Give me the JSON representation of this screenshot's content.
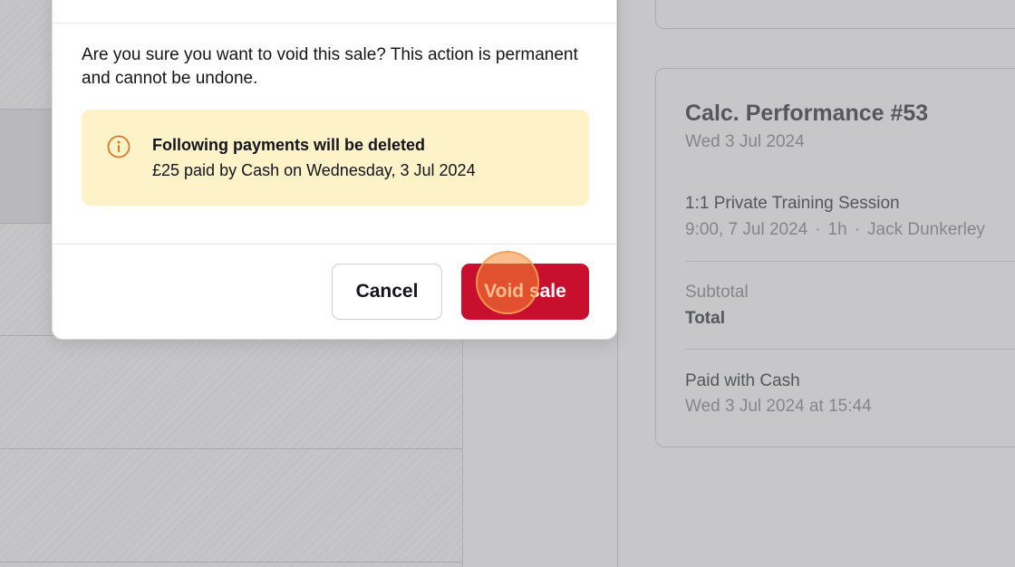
{
  "dialog": {
    "message": "Are you sure you want to void this sale? This action is permanent and cannot be undone.",
    "warning": {
      "icon": "info-icon",
      "title": "Following payments will be deleted",
      "detail": "£25 paid by Cash on Wednesday, 3 Jul 2024",
      "background_color": "#fdf2c8",
      "icon_color": "#d97a2b"
    },
    "cancel_label": "Cancel",
    "void_label": "Void sale",
    "void_color": "#c8102e"
  },
  "sale_summary": {
    "title": "Calc. Performance #53",
    "date": "Wed 3 Jul 2024",
    "item": {
      "name": "1:1 Private Training Session",
      "time": "9:00, 7 Jul 2024",
      "duration": "1h",
      "staff": "Jack Dunkerley"
    },
    "subtotal_label": "Subtotal",
    "total_label": "Total",
    "payment": {
      "label": "Paid with Cash",
      "timestamp": "Wed 3 Jul 2024 at 15:44"
    }
  }
}
